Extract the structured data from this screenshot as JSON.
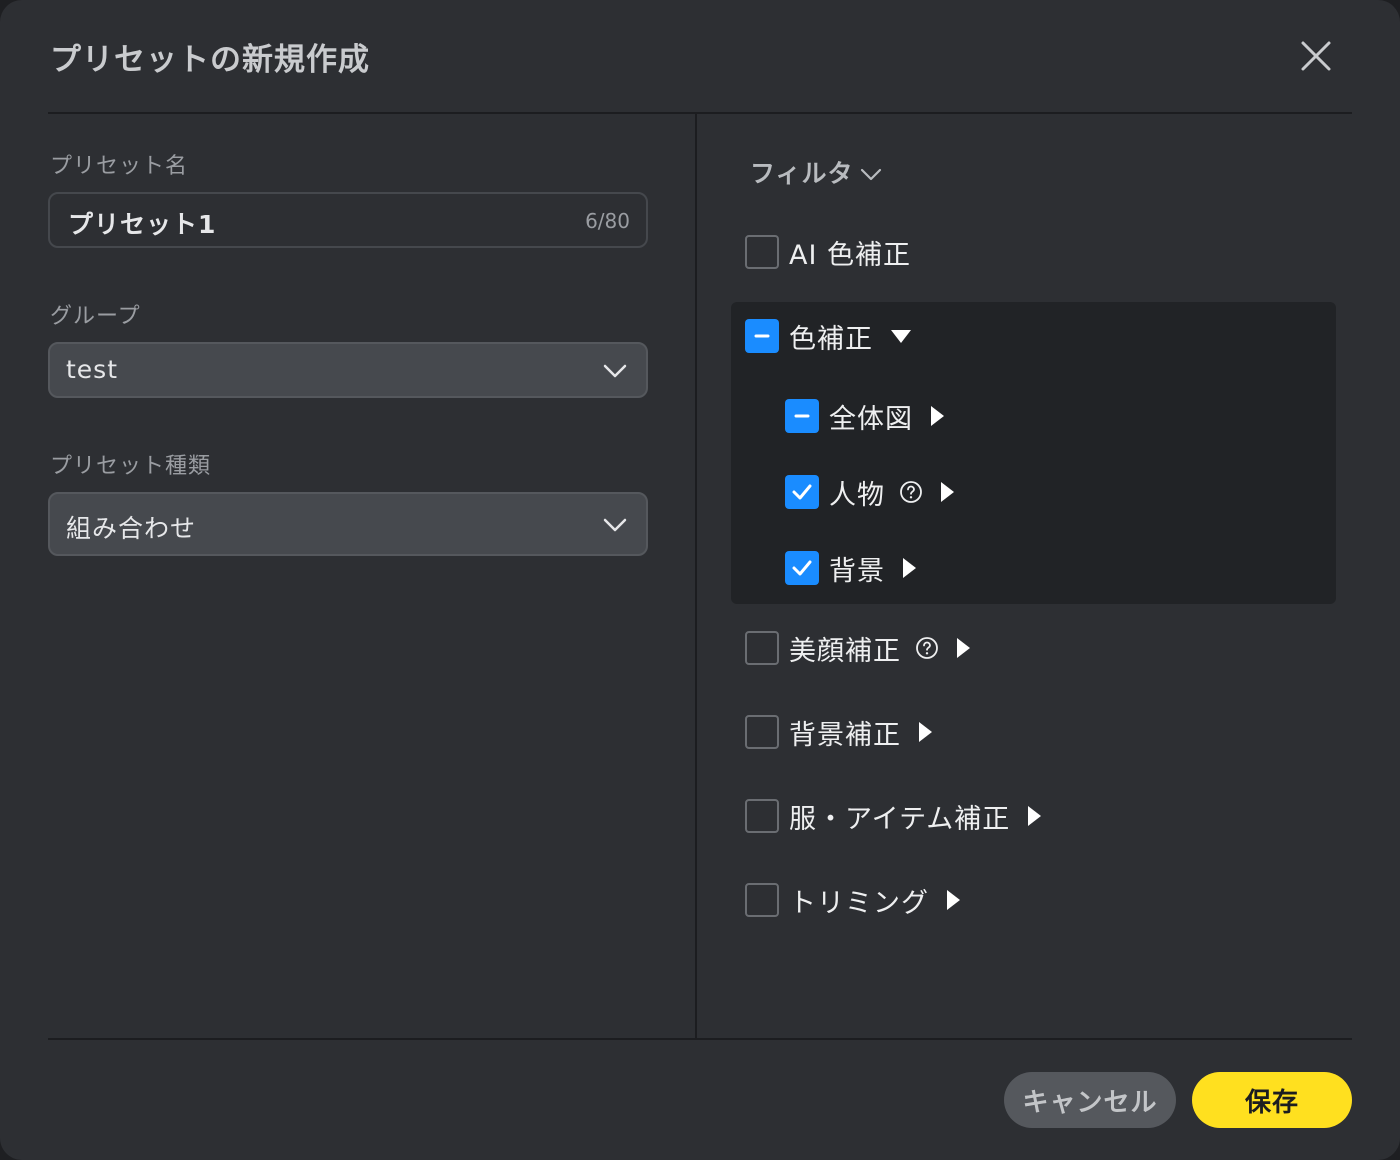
{
  "dialog": {
    "title": "プリセットの新規作成",
    "close_icon": "close-icon"
  },
  "left": {
    "name_label": "プリセット名",
    "name_value": "プリセット1",
    "name_counter": "6/80",
    "group_label": "グループ",
    "group_value": "test",
    "type_label": "プリセット種類",
    "type_value": "組み合わせ"
  },
  "filter": {
    "heading": "フィルタ",
    "items": [
      {
        "label": "AI 色補正",
        "state": "unchecked"
      },
      {
        "label": "色補正",
        "state": "indeterminate",
        "expanded": true
      },
      {
        "label": "全体図",
        "state": "indeterminate"
      },
      {
        "label": "人物",
        "state": "checked",
        "help": true
      },
      {
        "label": "背景",
        "state": "checked"
      },
      {
        "label": "美顔補正",
        "state": "unchecked",
        "help": true
      },
      {
        "label": "背景補正",
        "state": "unchecked"
      },
      {
        "label": "服・アイテム補正",
        "state": "unchecked"
      },
      {
        "label": "トリミング",
        "state": "unchecked"
      }
    ]
  },
  "footer": {
    "cancel_label": "キャンセル",
    "save_label": "保存"
  },
  "colors": {
    "accent": "#1a8cff",
    "save": "#ffe01f",
    "background": "#2d2f33"
  }
}
